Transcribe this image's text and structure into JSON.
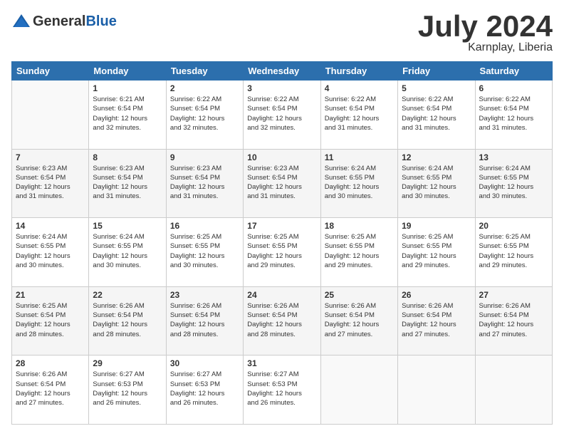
{
  "header": {
    "logo_general": "General",
    "logo_blue": "Blue",
    "title": "July 2024",
    "location": "Karnplay, Liberia"
  },
  "days_of_week": [
    "Sunday",
    "Monday",
    "Tuesday",
    "Wednesday",
    "Thursday",
    "Friday",
    "Saturday"
  ],
  "weeks": [
    [
      {
        "day": "",
        "info": ""
      },
      {
        "day": "1",
        "info": "Sunrise: 6:21 AM\nSunset: 6:54 PM\nDaylight: 12 hours\nand 32 minutes."
      },
      {
        "day": "2",
        "info": "Sunrise: 6:22 AM\nSunset: 6:54 PM\nDaylight: 12 hours\nand 32 minutes."
      },
      {
        "day": "3",
        "info": "Sunrise: 6:22 AM\nSunset: 6:54 PM\nDaylight: 12 hours\nand 32 minutes."
      },
      {
        "day": "4",
        "info": "Sunrise: 6:22 AM\nSunset: 6:54 PM\nDaylight: 12 hours\nand 31 minutes."
      },
      {
        "day": "5",
        "info": "Sunrise: 6:22 AM\nSunset: 6:54 PM\nDaylight: 12 hours\nand 31 minutes."
      },
      {
        "day": "6",
        "info": "Sunrise: 6:22 AM\nSunset: 6:54 PM\nDaylight: 12 hours\nand 31 minutes."
      }
    ],
    [
      {
        "day": "7",
        "info": "Sunrise: 6:23 AM\nSunset: 6:54 PM\nDaylight: 12 hours\nand 31 minutes."
      },
      {
        "day": "8",
        "info": "Sunrise: 6:23 AM\nSunset: 6:54 PM\nDaylight: 12 hours\nand 31 minutes."
      },
      {
        "day": "9",
        "info": "Sunrise: 6:23 AM\nSunset: 6:54 PM\nDaylight: 12 hours\nand 31 minutes."
      },
      {
        "day": "10",
        "info": "Sunrise: 6:23 AM\nSunset: 6:54 PM\nDaylight: 12 hours\nand 31 minutes."
      },
      {
        "day": "11",
        "info": "Sunrise: 6:24 AM\nSunset: 6:55 PM\nDaylight: 12 hours\nand 30 minutes."
      },
      {
        "day": "12",
        "info": "Sunrise: 6:24 AM\nSunset: 6:55 PM\nDaylight: 12 hours\nand 30 minutes."
      },
      {
        "day": "13",
        "info": "Sunrise: 6:24 AM\nSunset: 6:55 PM\nDaylight: 12 hours\nand 30 minutes."
      }
    ],
    [
      {
        "day": "14",
        "info": "Sunrise: 6:24 AM\nSunset: 6:55 PM\nDaylight: 12 hours\nand 30 minutes."
      },
      {
        "day": "15",
        "info": "Sunrise: 6:24 AM\nSunset: 6:55 PM\nDaylight: 12 hours\nand 30 minutes."
      },
      {
        "day": "16",
        "info": "Sunrise: 6:25 AM\nSunset: 6:55 PM\nDaylight: 12 hours\nand 30 minutes."
      },
      {
        "day": "17",
        "info": "Sunrise: 6:25 AM\nSunset: 6:55 PM\nDaylight: 12 hours\nand 29 minutes."
      },
      {
        "day": "18",
        "info": "Sunrise: 6:25 AM\nSunset: 6:55 PM\nDaylight: 12 hours\nand 29 minutes."
      },
      {
        "day": "19",
        "info": "Sunrise: 6:25 AM\nSunset: 6:55 PM\nDaylight: 12 hours\nand 29 minutes."
      },
      {
        "day": "20",
        "info": "Sunrise: 6:25 AM\nSunset: 6:55 PM\nDaylight: 12 hours\nand 29 minutes."
      }
    ],
    [
      {
        "day": "21",
        "info": "Sunrise: 6:25 AM\nSunset: 6:54 PM\nDaylight: 12 hours\nand 28 minutes."
      },
      {
        "day": "22",
        "info": "Sunrise: 6:26 AM\nSunset: 6:54 PM\nDaylight: 12 hours\nand 28 minutes."
      },
      {
        "day": "23",
        "info": "Sunrise: 6:26 AM\nSunset: 6:54 PM\nDaylight: 12 hours\nand 28 minutes."
      },
      {
        "day": "24",
        "info": "Sunrise: 6:26 AM\nSunset: 6:54 PM\nDaylight: 12 hours\nand 28 minutes."
      },
      {
        "day": "25",
        "info": "Sunrise: 6:26 AM\nSunset: 6:54 PM\nDaylight: 12 hours\nand 27 minutes."
      },
      {
        "day": "26",
        "info": "Sunrise: 6:26 AM\nSunset: 6:54 PM\nDaylight: 12 hours\nand 27 minutes."
      },
      {
        "day": "27",
        "info": "Sunrise: 6:26 AM\nSunset: 6:54 PM\nDaylight: 12 hours\nand 27 minutes."
      }
    ],
    [
      {
        "day": "28",
        "info": "Sunrise: 6:26 AM\nSunset: 6:54 PM\nDaylight: 12 hours\nand 27 minutes."
      },
      {
        "day": "29",
        "info": "Sunrise: 6:27 AM\nSunset: 6:53 PM\nDaylight: 12 hours\nand 26 minutes."
      },
      {
        "day": "30",
        "info": "Sunrise: 6:27 AM\nSunset: 6:53 PM\nDaylight: 12 hours\nand 26 minutes."
      },
      {
        "day": "31",
        "info": "Sunrise: 6:27 AM\nSunset: 6:53 PM\nDaylight: 12 hours\nand 26 minutes."
      },
      {
        "day": "",
        "info": ""
      },
      {
        "day": "",
        "info": ""
      },
      {
        "day": "",
        "info": ""
      }
    ]
  ]
}
